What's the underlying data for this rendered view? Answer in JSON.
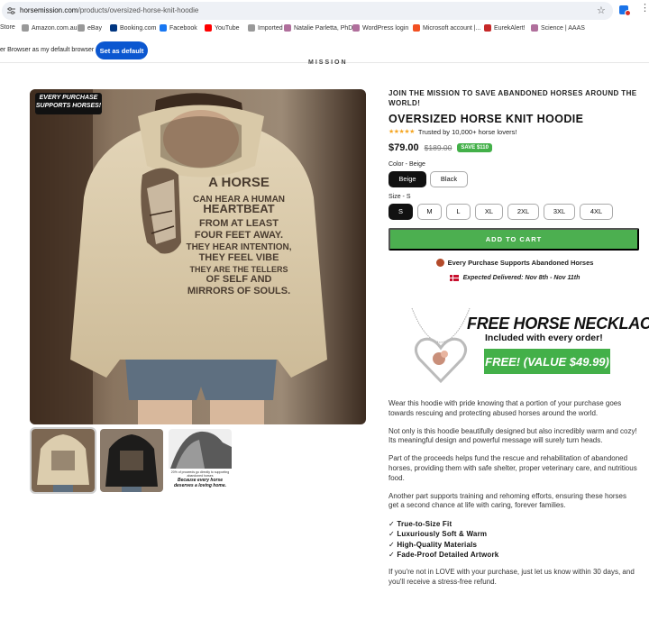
{
  "browser": {
    "url_prefix": "horsemission.com",
    "url_path": "/products/oversized-horse-knit-hoodie",
    "bookmarks": [
      {
        "label": "Store",
        "color": "#4285f4"
      },
      {
        "label": "Amazon.com.au",
        "color": "#999999"
      },
      {
        "label": "eBay",
        "color": "#999999"
      },
      {
        "label": "Booking.com",
        "color": "#003580"
      },
      {
        "label": "Facebook",
        "color": "#1877f2"
      },
      {
        "label": "YouTube",
        "color": "#ff0000"
      },
      {
        "label": "Imported",
        "color": "#999999"
      },
      {
        "label": "Natalie Parletta, PhD",
        "color": "#b06f9c"
      },
      {
        "label": "WordPress login",
        "color": "#b06f9c"
      },
      {
        "label": "Microsoft account |...",
        "color": "#f25022"
      },
      {
        "label": "EurekAlert!",
        "color": "#c62828"
      },
      {
        "label": "Science | AAAS",
        "color": "#b06f9c"
      }
    ],
    "notice_text": "er Browser as my default browser",
    "notice_button": "Set as default"
  },
  "store": {
    "logo": "MISSION"
  },
  "gallery": {
    "badge_line1": "EVERY PURCHASE",
    "badge_line2": "SUPPORTS HORSES!",
    "shirt_text": [
      "A HORSE",
      "CAN HEAR A HUMAN",
      "HEARTBEAT",
      "FROM AT LEAST",
      "FOUR FEET AWAY.",
      "THEY HEAR INTENTION,",
      "THEY FEEL VIBE",
      "THEY ARE THE TELLERS",
      "OF SELF AND",
      "MIRRORS OF SOULS."
    ],
    "thumb3_caption1": "20% of proceeds go directly to supporting abandoned horses",
    "thumb3_caption2": "Because every horse deserves a loving home."
  },
  "product": {
    "mission": "JOIN THE MISSION TO SAVE ABANDONED HORSES AROUND THE WORLD!",
    "title": "OVERSIZED HORSE KNIT HOODIE",
    "rating_stars": 5,
    "rating_text": "Trusted by 10,000+ horse lovers!",
    "price": "$79.00",
    "compare_price": "$189.00",
    "save_badge": "SAVE $110",
    "color_label": "Color - Beige",
    "colors": [
      {
        "label": "Beige",
        "selected": true
      },
      {
        "label": "Black",
        "selected": false
      }
    ],
    "size_label": "Size - S",
    "sizes": [
      {
        "label": "S",
        "selected": true
      },
      {
        "label": "M"
      },
      {
        "label": "L"
      },
      {
        "label": "XL"
      },
      {
        "label": "2XL"
      },
      {
        "label": "3XL"
      },
      {
        "label": "4XL"
      }
    ],
    "add_to_cart": "ADD TO CART",
    "supports_text": "Every Purchase Supports Abandoned Horses",
    "delivery_text": "Expected Delivered:  Nov 8th - Nov 11th"
  },
  "necklace_promo": {
    "headline": "FREE HORSE NECKLACE",
    "subhead": "Included with every order!",
    "value_button": "FREE! (VALUE $49.99)"
  },
  "description": {
    "p1": "Wear this hoodie with pride knowing that a portion of your purchase goes towards rescuing and protecting abused horses around the world.",
    "p2": "Not only is this hoodie beautifully designed but also incredibly warm and cozy! Its meaningful design and powerful message will surely turn heads.",
    "p3": "Part of the proceeds helps fund the rescue and rehabilitation of abandoned horses, providing them with safe shelter, proper veterinary care, and nutritious food.",
    "p4": "Another part supports training and rehoming efforts, ensuring these horses get a second chance at life with caring, forever families.",
    "checklist": [
      "✓ True-to-Size Fit",
      "✓ Luxuriously Soft & Warm",
      "✓ High-Quality Materials",
      "✓ Fade-Proof Detailed Artwork"
    ],
    "p5": "If you're not in LOVE with your purchase, just let us know within 30 days, and you'll receive a stress-free refund."
  }
}
